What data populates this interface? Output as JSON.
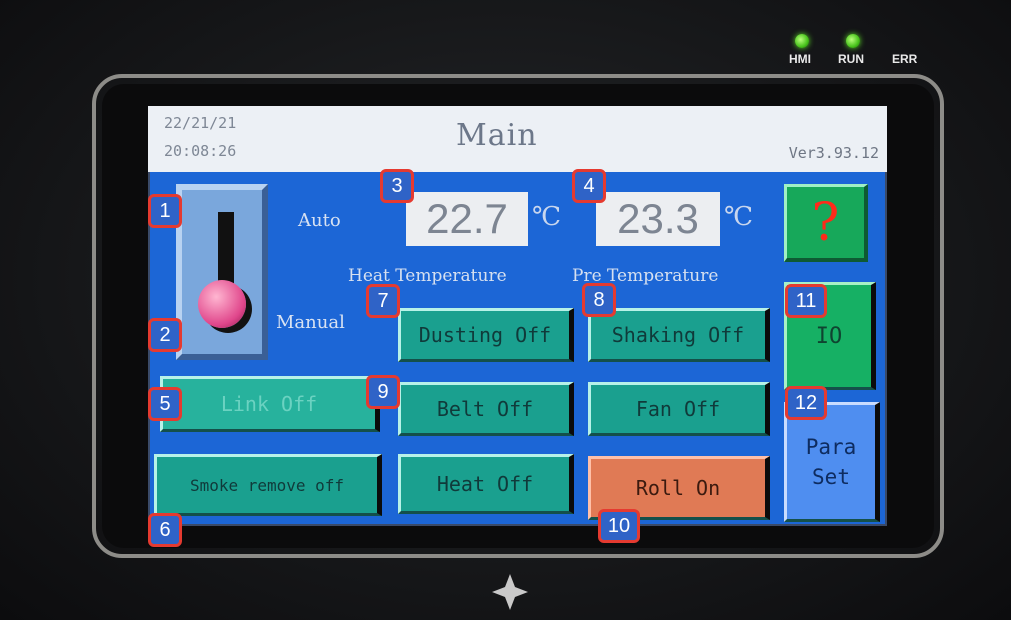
{
  "device": {
    "indicators": [
      {
        "label": "HMI",
        "lit": true
      },
      {
        "label": "RUN",
        "lit": true
      },
      {
        "label": "ERR",
        "lit": false
      }
    ]
  },
  "screen": {
    "date": "22/21/21",
    "time": "20:08:26",
    "title": "Main",
    "version": "Ver3.93.12",
    "mode_switch": {
      "auto_label": "Auto",
      "manual_label": "Manual",
      "position": "Manual"
    },
    "temperatures": [
      {
        "value": "22.7",
        "unit": "℃",
        "caption": "Heat Temperature"
      },
      {
        "value": "23.3",
        "unit": "℃",
        "caption": "Pre Temperature"
      }
    ],
    "help_button": "?",
    "buttons": {
      "link": "Link Off",
      "smoke": "Smoke remove off",
      "dusting": "Dusting Off",
      "shaking": "Shaking Off",
      "belt": "Belt Off",
      "fan": "Fan Off",
      "heat": "Heat Off",
      "roll": "Roll On",
      "io": "IO",
      "para_line1": "Para",
      "para_line2": "Set"
    }
  },
  "callouts": [
    "1",
    "2",
    "3",
    "4",
    "5",
    "6",
    "7",
    "8",
    "9",
    "10",
    "11",
    "12"
  ],
  "colors": {
    "screen_bg": "#1c66d6",
    "button_teal": "#1aa08f",
    "button_orange": "#e07a55",
    "button_green": "#16b064",
    "button_blue": "#4f8ef0",
    "callout_border": "#e53a30",
    "callout_fill": "#2f63c7"
  }
}
